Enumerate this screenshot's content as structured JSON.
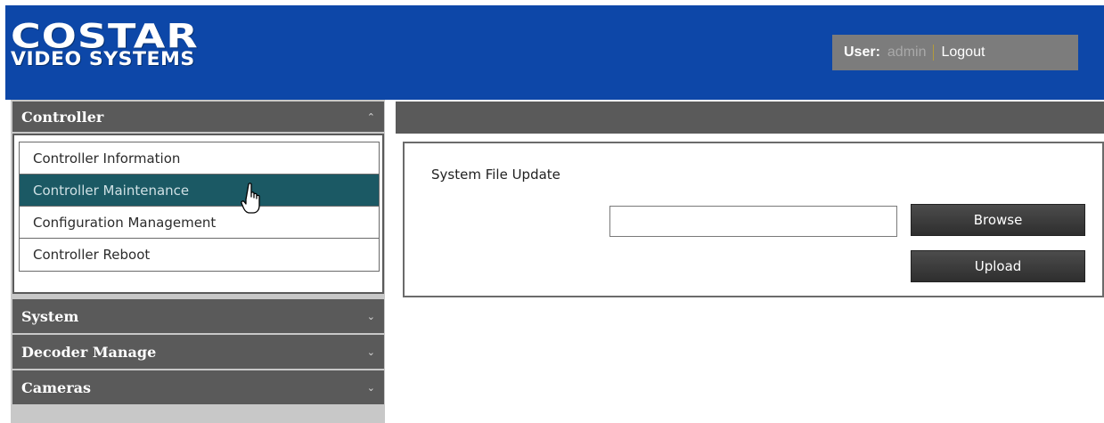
{
  "header": {
    "logo_main": "COSTAR",
    "logo_sub": "VIDEO SYSTEMS",
    "user_label": "User:",
    "user_name": "admin",
    "logout_label": "Logout",
    "background_color": "#0d47a8"
  },
  "sidebar": {
    "sections": [
      {
        "label": "Controller",
        "expanded": true,
        "chevron_icon": "chevron-up-icon"
      },
      {
        "label": "System",
        "expanded": false,
        "chevron_icon": "chevron-down-icon"
      },
      {
        "label": "Decoder Manage",
        "expanded": false,
        "chevron_icon": "chevron-down-icon"
      },
      {
        "label": "Cameras",
        "expanded": false,
        "chevron_icon": "chevron-down-icon"
      }
    ],
    "controller_items": [
      {
        "label": "Controller Information",
        "active": false
      },
      {
        "label": "Controller Maintenance",
        "active": true
      },
      {
        "label": "Configuration Management",
        "active": false
      },
      {
        "label": "Controller Reboot",
        "active": false
      }
    ],
    "active_color": "#1b5964"
  },
  "main": {
    "panel_title": "System File Update",
    "file_input_value": "",
    "browse_label": "Browse",
    "upload_label": "Upload"
  }
}
